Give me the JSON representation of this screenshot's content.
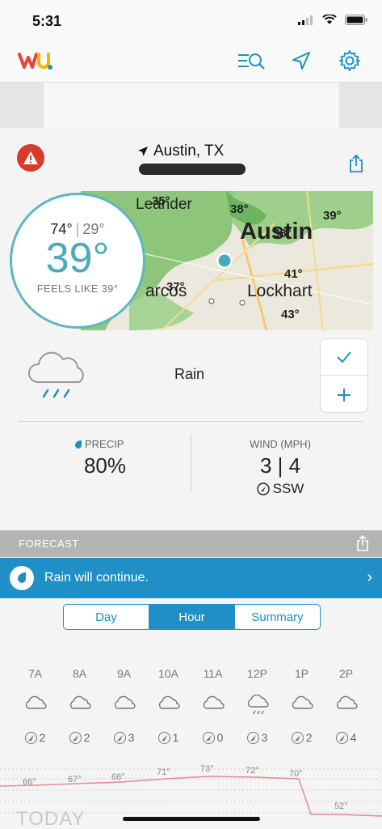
{
  "status_bar": {
    "time": "5:31"
  },
  "header": {
    "logo": "wu",
    "icons": [
      "search-list-icon",
      "location-arrow-icon",
      "gear-icon"
    ]
  },
  "location": {
    "name": "Austin, TX"
  },
  "current": {
    "high": "74°",
    "low": "29°",
    "temp": "39°",
    "feels_like": "FEELS LIKE 39°",
    "condition": "Rain"
  },
  "map": {
    "labels": [
      {
        "text": "35°",
        "color": "#2aa7b5"
      },
      {
        "text": "38°",
        "color": "#2aa7b5"
      },
      {
        "text": "39°",
        "color": "#2aa7b5"
      },
      {
        "text": "38°",
        "color": "#2aa7b5"
      },
      {
        "text": "37°",
        "color": "#2aa7b5"
      },
      {
        "text": "41°",
        "color": "#2bab2b"
      },
      {
        "text": "43°",
        "color": "#2bab2b"
      },
      {
        "text": "Leander",
        "color": "#555"
      },
      {
        "text": "Austin",
        "color": "#444"
      },
      {
        "text": "Lockhart",
        "color": "#444"
      },
      {
        "text": "arcos",
        "color": "#444"
      }
    ]
  },
  "precip": {
    "label": "PRECIP",
    "value": "80%"
  },
  "wind": {
    "label": "WIND (MPH)",
    "value": "3 | 4",
    "direction": "SSW"
  },
  "forecast": {
    "label": "FORECAST",
    "banner": "Rain will continue.",
    "tabs": [
      "Day",
      "Hour",
      "Summary"
    ],
    "active_tab": "Hour"
  },
  "hourly": [
    {
      "time": "7A",
      "icon": "cloud-icon",
      "wind": "2"
    },
    {
      "time": "8A",
      "icon": "cloud-icon",
      "wind": "2"
    },
    {
      "time": "9A",
      "icon": "cloud-icon",
      "wind": "3"
    },
    {
      "time": "10A",
      "icon": "cloud-icon",
      "wind": "1"
    },
    {
      "time": "11A",
      "icon": "cloud-icon",
      "wind": "0"
    },
    {
      "time": "12P",
      "icon": "rain-cloud-icon",
      "wind": "3"
    },
    {
      "time": "1P",
      "icon": "cloud-icon",
      "wind": "2"
    },
    {
      "time": "2P",
      "icon": "cloud-icon",
      "wind": "4"
    }
  ],
  "temp_graph": [
    "66°",
    "67°",
    "68°",
    "71°",
    "73°",
    "72°",
    "70°",
    "52°"
  ],
  "today_label": "TODAY",
  "colors": {
    "accent": "#1f8fc6",
    "temp": "#4baab9",
    "alert": "#d83a2c"
  }
}
